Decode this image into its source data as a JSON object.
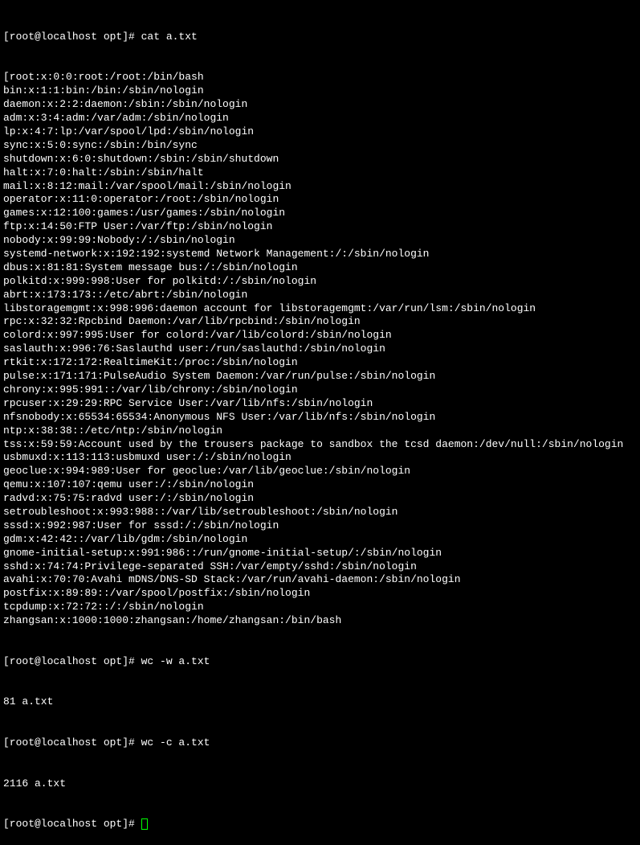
{
  "terminal": {
    "prompt1": "[root@localhost opt]# cat a.txt",
    "lines": [
      "[root:x:0:0:root:/root:/bin/bash",
      "bin:x:1:1:bin:/bin:/sbin/nologin",
      "daemon:x:2:2:daemon:/sbin:/sbin/nologin",
      "adm:x:3:4:adm:/var/adm:/sbin/nologin",
      "lp:x:4:7:lp:/var/spool/lpd:/sbin/nologin",
      "sync:x:5:0:sync:/sbin:/bin/sync",
      "shutdown:x:6:0:shutdown:/sbin:/sbin/shutdown",
      "halt:x:7:0:halt:/sbin:/sbin/halt",
      "mail:x:8:12:mail:/var/spool/mail:/sbin/nologin",
      "operator:x:11:0:operator:/root:/sbin/nologin",
      "games:x:12:100:games:/usr/games:/sbin/nologin",
      "ftp:x:14:50:FTP User:/var/ftp:/sbin/nologin",
      "nobody:x:99:99:Nobody:/:/sbin/nologin",
      "systemd-network:x:192:192:systemd Network Management:/:/sbin/nologin",
      "dbus:x:81:81:System message bus:/:/sbin/nologin",
      "polkitd:x:999:998:User for polkitd:/:/sbin/nologin",
      "abrt:x:173:173::/etc/abrt:/sbin/nologin",
      "libstoragemgmt:x:998:996:daemon account for libstoragemgmt:/var/run/lsm:/sbin/nologin",
      "rpc:x:32:32:Rpcbind Daemon:/var/lib/rpcbind:/sbin/nologin",
      "colord:x:997:995:User for colord:/var/lib/colord:/sbin/nologin",
      "saslauth:x:996:76:Saslauthd user:/run/saslauthd:/sbin/nologin",
      "rtkit:x:172:172:RealtimeKit:/proc:/sbin/nologin",
      "pulse:x:171:171:PulseAudio System Daemon:/var/run/pulse:/sbin/nologin",
      "chrony:x:995:991::/var/lib/chrony:/sbin/nologin",
      "rpcuser:x:29:29:RPC Service User:/var/lib/nfs:/sbin/nologin",
      "nfsnobody:x:65534:65534:Anonymous NFS User:/var/lib/nfs:/sbin/nologin",
      "ntp:x:38:38::/etc/ntp:/sbin/nologin",
      "tss:x:59:59:Account used by the trousers package to sandbox the tcsd daemon:/dev/null:/sbin/nologin",
      "usbmuxd:x:113:113:usbmuxd user:/:/sbin/nologin",
      "geoclue:x:994:989:User for geoclue:/var/lib/geoclue:/sbin/nologin",
      "qemu:x:107:107:qemu user:/:/sbin/nologin",
      "radvd:x:75:75:radvd user:/:/sbin/nologin",
      "setroubleshoot:x:993:988::/var/lib/setroubleshoot:/sbin/nologin",
      "sssd:x:992:987:User for sssd:/:/sbin/nologin",
      "gdm:x:42:42::/var/lib/gdm:/sbin/nologin",
      "gnome-initial-setup:x:991:986::/run/gnome-initial-setup/:/sbin/nologin",
      "sshd:x:74:74:Privilege-separated SSH:/var/empty/sshd:/sbin/nologin",
      "avahi:x:70:70:Avahi mDNS/DNS-SD Stack:/var/run/avahi-daemon:/sbin/nologin",
      "postfix:x:89:89::/var/spool/postfix:/sbin/nologin",
      "tcpdump:x:72:72::/:/sbin/nologin",
      "zhangsan:x:1000:1000:zhangsan:/home/zhangsan:/bin/bash"
    ],
    "prompt2": "[root@localhost opt]# wc -w a.txt",
    "output2": "81 a.txt",
    "prompt3": "[root@localhost opt]# wc -c a.txt",
    "output3": "2116 a.txt",
    "prompt4": "[root@localhost opt]# "
  }
}
